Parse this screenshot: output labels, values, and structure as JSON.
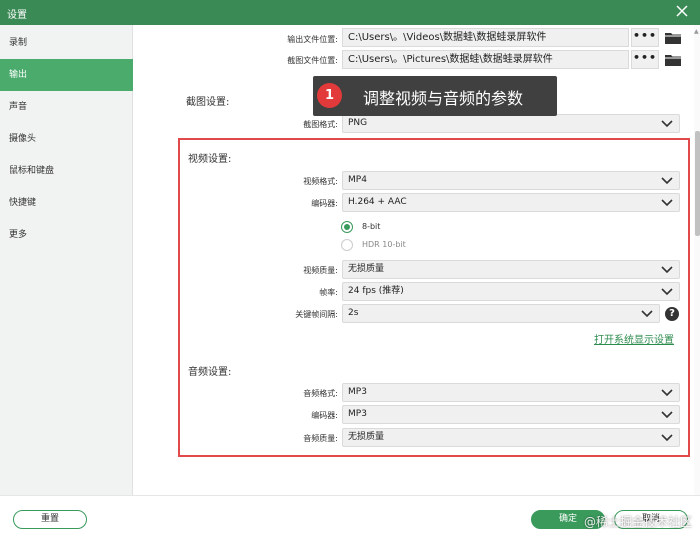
{
  "window": {
    "title": "设置"
  },
  "sidebar": {
    "items": [
      {
        "label": "录制",
        "active": false
      },
      {
        "label": "输出",
        "active": true
      },
      {
        "label": "声音",
        "active": false
      },
      {
        "label": "摄像头",
        "active": false
      },
      {
        "label": "鼠标和键盘",
        "active": false
      },
      {
        "label": "快捷键",
        "active": false
      },
      {
        "label": "更多",
        "active": false
      }
    ]
  },
  "output": {
    "video_path_label": "输出文件位置:",
    "video_path_value": "C:\\Users\\。\\Videos\\数据蛙\\数据蛙录屏软件",
    "screenshot_path_label": "截图文件位置:",
    "screenshot_path_value": "C:\\Users\\。\\Pictures\\数据蛙\\数据蛙录屏软件",
    "dots": "•••"
  },
  "screenshot_settings": {
    "title": "截图设置:",
    "format_label": "截图格式:",
    "format_value": "PNG"
  },
  "video_settings": {
    "title": "视频设置:",
    "format_label": "视频格式:",
    "format_value": "MP4",
    "encoder_label": "编码器:",
    "encoder_value": "H.264 + AAC",
    "bit_options": [
      "8-bit",
      "HDR 10-bit"
    ],
    "bit_selected": "8-bit",
    "quality_label": "视频质量:",
    "quality_value": "无损质量",
    "fps_label": "帧率:",
    "fps_value": "24 fps (推荐)",
    "keyframe_label": "关键帧间隔:",
    "keyframe_value": "2s",
    "help": "?",
    "display_link": "打开系统显示设置"
  },
  "audio_settings": {
    "title": "音频设置:",
    "format_label": "音频格式:",
    "format_value": "MP3",
    "encoder_label": "编码器:",
    "encoder_value": "MP3",
    "quality_label": "音频质量:",
    "quality_value": "无损质量"
  },
  "annotation": {
    "badge": "1",
    "text": "调整视频与音频的参数",
    "highlight_color": "#e04a4a"
  },
  "footer": {
    "reset_label": "重置",
    "ok_label": "确定",
    "cancel_label": "取消"
  },
  "watermark": "@稀土掘金技术社区",
  "colors": {
    "accent": "#3a9a5c",
    "titlebar": "#3a8a55",
    "active_nav": "#4aab6d"
  }
}
